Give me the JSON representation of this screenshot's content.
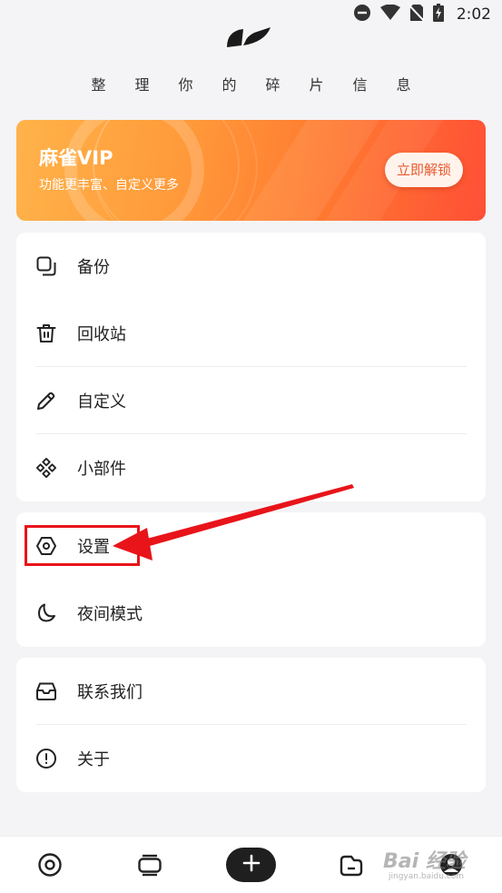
{
  "status_bar": {
    "time": "2:02",
    "icons": [
      "dnd-icon",
      "wifi-icon",
      "no-sim-icon",
      "battery-charging-icon"
    ]
  },
  "header": {
    "logo_icon": "feather-logo-icon",
    "slogan": "整理你的碎片信息"
  },
  "vip_banner": {
    "title": "麻雀VIP",
    "subtitle": "功能更丰富、自定义更多",
    "button_label": "立即解锁",
    "colors": {
      "start": "#ffb34a",
      "end": "#ff4f36",
      "button_text": "#e85a2e"
    }
  },
  "menu_groups": [
    {
      "items": [
        {
          "label": "备份",
          "icon": "backup-copy-icon"
        },
        {
          "label": "回收站",
          "icon": "trash-icon"
        },
        {
          "label": "自定义",
          "icon": "pencil-icon"
        },
        {
          "label": "小部件",
          "icon": "widget-diamonds-icon"
        }
      ]
    },
    {
      "items": [
        {
          "label": "设置",
          "icon": "settings-hexagon-icon"
        },
        {
          "label": "夜间模式",
          "icon": "moon-icon"
        }
      ]
    },
    {
      "items": [
        {
          "label": "联系我们",
          "icon": "inbox-icon"
        },
        {
          "label": "关于",
          "icon": "info-icon"
        }
      ]
    }
  ],
  "annotation": {
    "highlight_color": "#e8141a"
  },
  "bottom_nav": {
    "items": [
      "home-circle-icon",
      "cards-stack-icon",
      "add-icon",
      "folder-icon",
      "profile-icon"
    ]
  },
  "watermark": {
    "text": "Bai 经验",
    "sub": "jingyan.baidu.com"
  }
}
